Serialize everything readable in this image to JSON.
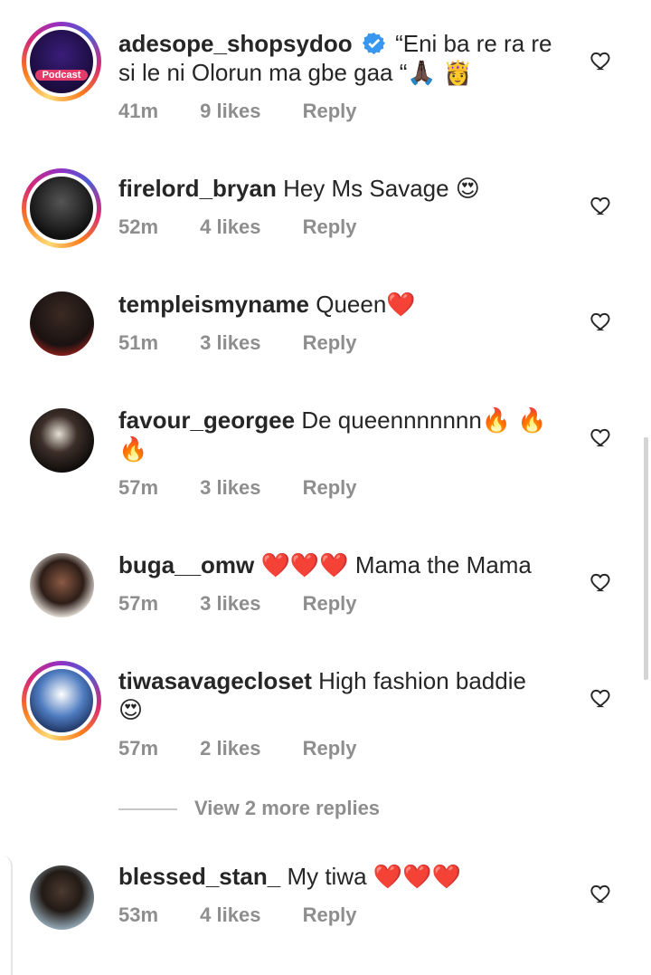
{
  "comments": [
    {
      "username": "adesope_shopsydoo",
      "verified": true,
      "text_line1": "“Eni ba re ra re",
      "text_line2": "si le ni Olorun ma gbe gaa “🙏🏿 👸",
      "time": "41m",
      "likes": "9 likes",
      "reply": "Reply",
      "avatar_text": "Podcast",
      "avatar_icon": "podcast-avatar"
    },
    {
      "username": "firelord_bryan",
      "text_line1": "Hey Ms Savage 😍",
      "time": "52m",
      "likes": "4 likes",
      "reply": "Reply",
      "avatar_icon": "person-avatar"
    },
    {
      "username": "templeismyname",
      "text_line1": "Queen❤️",
      "time": "51m",
      "likes": "3 likes",
      "reply": "Reply",
      "avatar_icon": "person-avatar"
    },
    {
      "username": "favour_georgee",
      "text_line1": "De queennnnnnn🔥 🔥",
      "text_line2": "🔥",
      "time": "57m",
      "likes": "3 likes",
      "reply": "Reply",
      "avatar_icon": "person-avatar"
    },
    {
      "username": "buga__omw",
      "text_line1": "❤️❤️❤️ Mama the Mama",
      "time": "57m",
      "likes": "3 likes",
      "reply": "Reply",
      "avatar_icon": "person-avatar"
    },
    {
      "username": "tiwasavagecloset",
      "text_line1": "High fashion baddie",
      "text_line2": "😍",
      "time": "57m",
      "likes": "2 likes",
      "reply": "Reply",
      "avatar_icon": "person-avatar"
    },
    {
      "username": "blessed_stan_",
      "text_line1": "My tiwa ❤️❤️❤️",
      "time": "53m",
      "likes": "4 likes",
      "reply": "Reply",
      "avatar_icon": "person-avatar"
    }
  ],
  "view_more_replies": "View 2 more replies",
  "colors": {
    "text": "#262626",
    "muted": "#8e8e8e",
    "verified_blue": "#3897f0",
    "ring_gradient": [
      "#feda75",
      "#fa7e1e",
      "#d62976",
      "#962fbf",
      "#4f5bd5"
    ]
  },
  "icons": {
    "like": "heart-outline-icon",
    "verified": "verified-badge-icon"
  }
}
